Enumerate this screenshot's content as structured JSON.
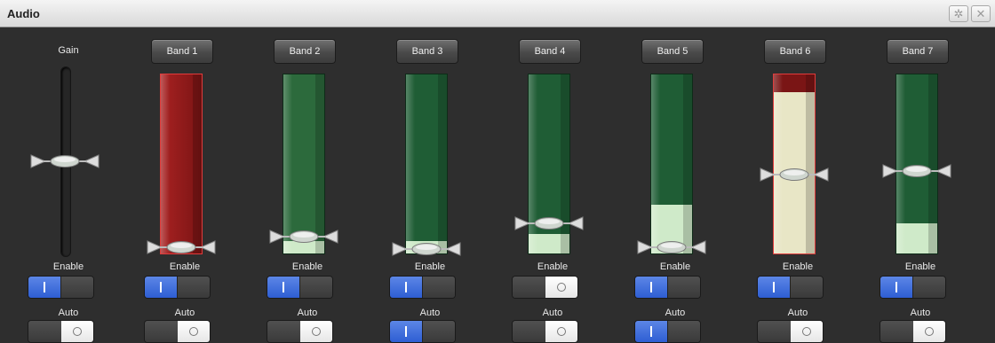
{
  "window": {
    "title": "Audio",
    "settings_icon": "gear-icon",
    "close_icon": "close-icon"
  },
  "gain": {
    "label": "Gain",
    "level": 0.5,
    "enable_label": "Enable",
    "enable": true,
    "auto_label": "Auto",
    "auto": false
  },
  "bands": [
    {
      "label": "Band 1",
      "color": "#8a1a1a",
      "fill_color": "#8a1a1a",
      "level": 0.04,
      "bar_level": 1.0,
      "enable_label": "Enable",
      "enable": true,
      "auto_label": "Auto",
      "auto": false
    },
    {
      "label": "Band 2",
      "color": "#2c6a3c",
      "fill_color": "#cfeac9",
      "level": 0.1,
      "bar_level": 0.07,
      "enable_label": "Enable",
      "enable": true,
      "auto_label": "Auto",
      "auto": false
    },
    {
      "label": "Band 3",
      "color": "#1f5d35",
      "fill_color": "#cfeac9",
      "level": 0.03,
      "bar_level": 0.07,
      "enable_label": "Enable",
      "enable": true,
      "auto_label": "Auto",
      "auto": true
    },
    {
      "label": "Band 4",
      "color": "#1f5d35",
      "fill_color": "#cfeac9",
      "level": 0.17,
      "bar_level": 0.11,
      "enable_label": "Enable",
      "enable": false,
      "auto_label": "Auto",
      "auto": false
    },
    {
      "label": "Band 5",
      "color": "#1f5d35",
      "fill_color": "#cfeac9",
      "level": 0.04,
      "bar_level": 0.27,
      "enable_label": "Enable",
      "enable": true,
      "auto_label": "Auto",
      "auto": true
    },
    {
      "label": "Band 6",
      "color": "#7a1515",
      "fill_color": "#e8e6c6",
      "level": 0.44,
      "bar_level": 0.9,
      "enable_label": "Enable",
      "enable": true,
      "auto_label": "Auto",
      "auto": false
    },
    {
      "label": "Band 7",
      "color": "#1f5d35",
      "fill_color": "#cfeac9",
      "level": 0.46,
      "bar_level": 0.17,
      "enable_label": "Enable",
      "enable": true,
      "auto_label": "Auto",
      "auto": false
    }
  ]
}
